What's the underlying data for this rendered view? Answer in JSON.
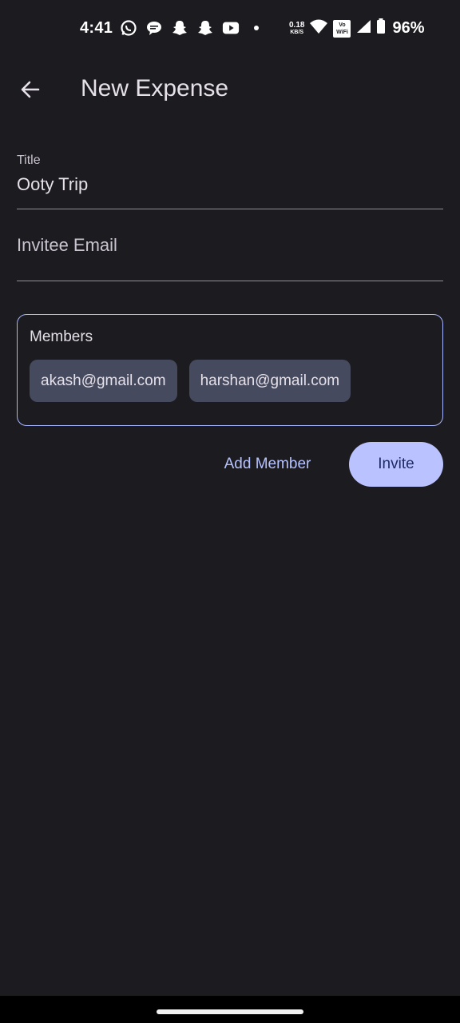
{
  "status_bar": {
    "time": "4:41",
    "notification_icons": [
      "whatsapp-icon",
      "chat-bubble-icon",
      "snapchat-icon",
      "snapchat-icon",
      "youtube-icon",
      "dot-icon"
    ],
    "net_speed_value": "0.18",
    "net_speed_unit": "KB/S",
    "vowifi_line1": "Vo",
    "vowifi_line2": "WiFi",
    "battery": "96%"
  },
  "app_bar": {
    "title": "New Expense"
  },
  "form": {
    "title_label": "Title",
    "title_value": "Ooty Trip",
    "email_placeholder": "Invitee Email"
  },
  "members": {
    "label": "Members",
    "chips": [
      "akash@gmail.com",
      "harshan@gmail.com"
    ]
  },
  "actions": {
    "add_member_label": "Add Member",
    "invite_label": "Invite"
  },
  "colors": {
    "background": "#1c1b20",
    "accent": "#bac3ff",
    "chip_bg": "#454a5f",
    "card_border": "#a8b6ff"
  }
}
